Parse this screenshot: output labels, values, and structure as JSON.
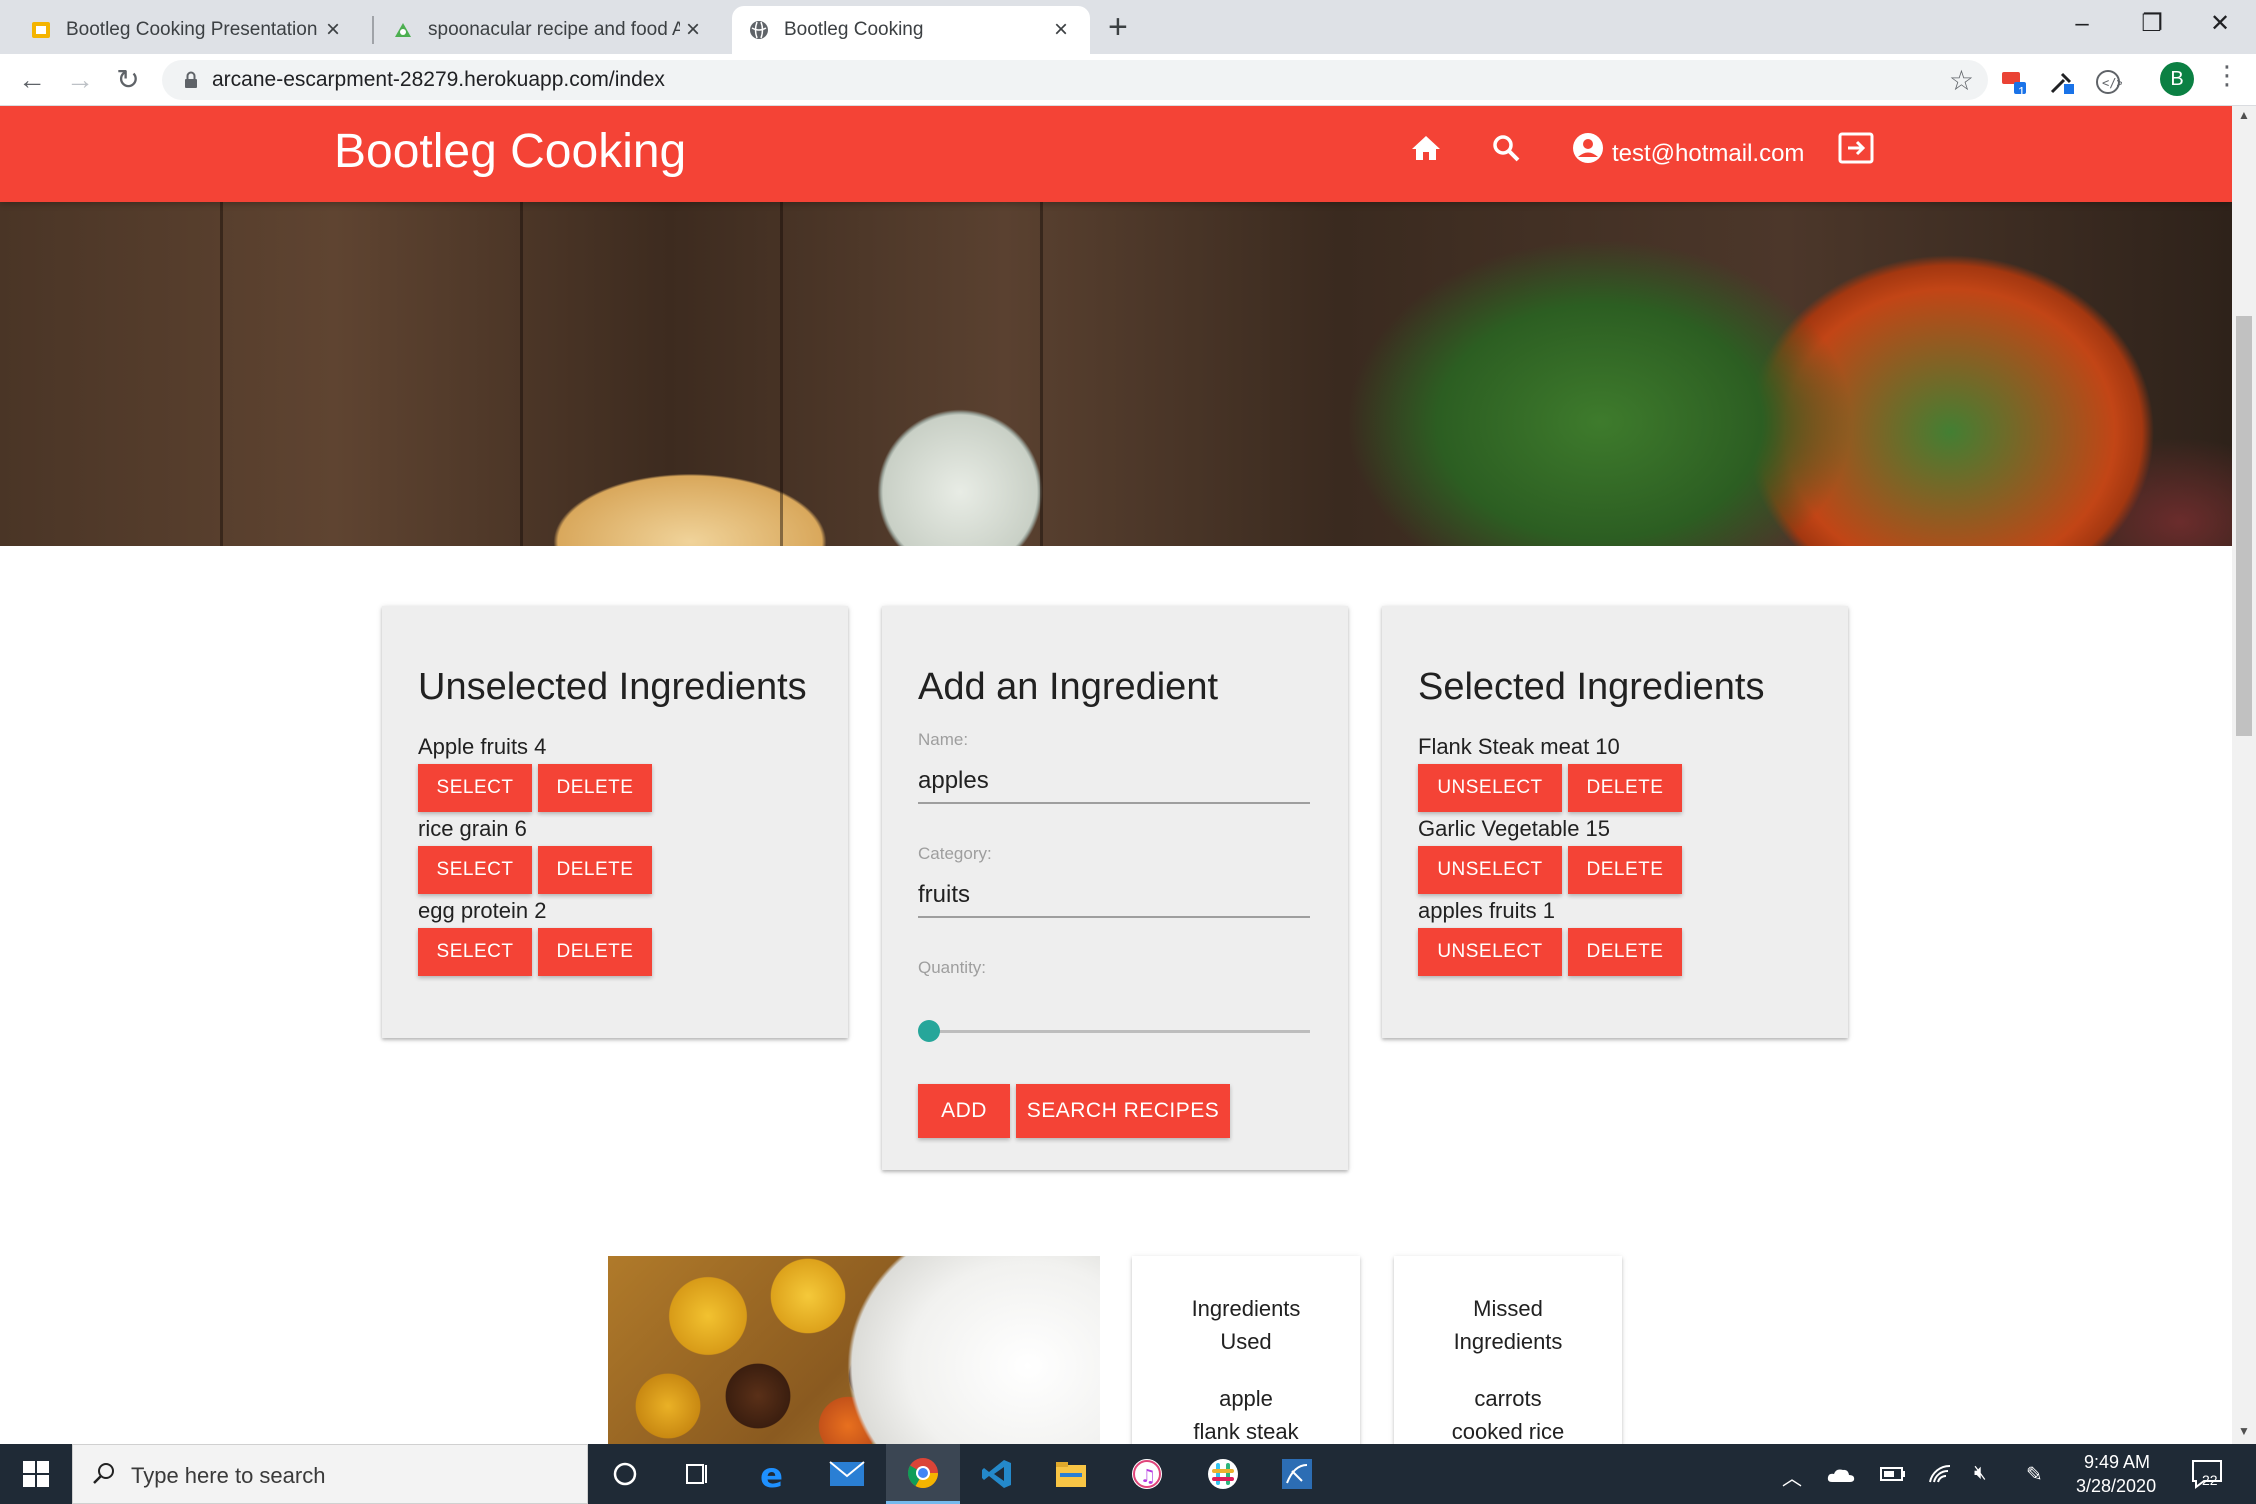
{
  "browser": {
    "tabs": [
      {
        "title": "Bootleg Cooking Presentation - G",
        "active": false,
        "icon": "slides-icon"
      },
      {
        "title": "spoonacular recipe and food API",
        "active": false,
        "icon": "spoonacular-icon"
      },
      {
        "title": "Bootleg Cooking",
        "active": true,
        "icon": "globe-icon"
      }
    ],
    "url": "arcane-escarpment-28279.herokuapp.com/index",
    "profile_initial": "B",
    "extension_badge": "1"
  },
  "app": {
    "brand": "Bootleg Cooking",
    "user_email": "test@hotmail.com",
    "accent_color": "#f44336",
    "nav_icons": [
      "home-icon",
      "search-icon",
      "account-circle-icon",
      "logout-icon"
    ]
  },
  "unselected": {
    "title": "Unselected Ingredients",
    "select_label": "SELECT",
    "delete_label": "DELETE",
    "items": [
      {
        "label": "Apple fruits 4"
      },
      {
        "label": "rice grain 6"
      },
      {
        "label": "egg protein 2"
      }
    ]
  },
  "add_form": {
    "title": "Add an Ingredient",
    "name_label": "Name:",
    "name_value": "apples",
    "category_label": "Category:",
    "category_value": "fruits",
    "quantity_label": "Quantity:",
    "quantity_fraction": 0,
    "add_label": "ADD",
    "search_label": "SEARCH RECIPES"
  },
  "selected": {
    "title": "Selected Ingredients",
    "unselect_label": "UNSELECT",
    "delete_label": "DELETE",
    "items": [
      {
        "label": "Flank Steak meat 10"
      },
      {
        "label": "Garlic Vegetable 15"
      },
      {
        "label": "apples fruits 1"
      }
    ]
  },
  "result": {
    "used_heading": "Ingredients Used",
    "used_items": [
      "apple",
      "flank steak"
    ],
    "missed_heading": "Missed Ingredients",
    "missed_items": [
      "carrots",
      "cooked rice"
    ]
  },
  "taskbar": {
    "search_placeholder": "Type here to search",
    "time": "9:49 AM",
    "date": "3/28/2020",
    "notification_count": "22"
  }
}
